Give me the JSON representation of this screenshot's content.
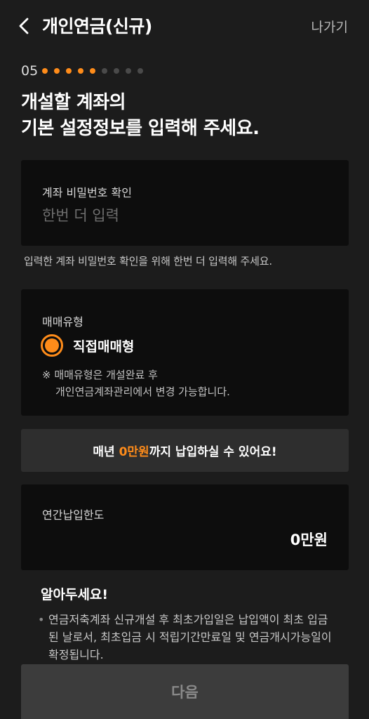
{
  "header": {
    "title": "개인연금(신규)",
    "exit_label": "나가기",
    "back_icon": "chevron-left-icon"
  },
  "progress": {
    "step": "05",
    "total_steps": 9,
    "completed_steps": 5,
    "active_color": "#ff8c1a",
    "inactive_color": "#4a4a4a"
  },
  "main_title": {
    "line1": "개설할 계좌의",
    "line2": "기본 설정정보를 입력해 주세요."
  },
  "password_confirm": {
    "label": "계좌 비밀번호 확인",
    "value": "",
    "placeholder": "한번 더 입력",
    "help": "입력한 계좌 비밀번호 확인을 위해 한번 더 입력해 주세요."
  },
  "trade_type": {
    "label": "매매유형",
    "option_label": "직접매매형",
    "selected": true,
    "note_line1": "※ 매매유형은 개설완료 후",
    "note_line2": "개인연금계좌관리에서 변경 가능합니다."
  },
  "banner": {
    "prefix": "매년 ",
    "amount": "0만원",
    "suffix": "까지 납입하실 수 있어요!"
  },
  "annual_limit": {
    "label": "연간납입한도",
    "value": "0만원"
  },
  "notice": {
    "title": "알아두세요!",
    "bullet": "•",
    "text": "연금저축계좌 신규개설 후 최초가입일은 납입액이 최초 입금된 날로서, 최초입금 시 적립기간만료일 및 연금개시가능일이 확정됩니다."
  },
  "next_button": {
    "label": "다음"
  },
  "colors": {
    "accent": "#ff8c1a",
    "background": "#1c1c1c",
    "card": "#0d0d0d"
  }
}
